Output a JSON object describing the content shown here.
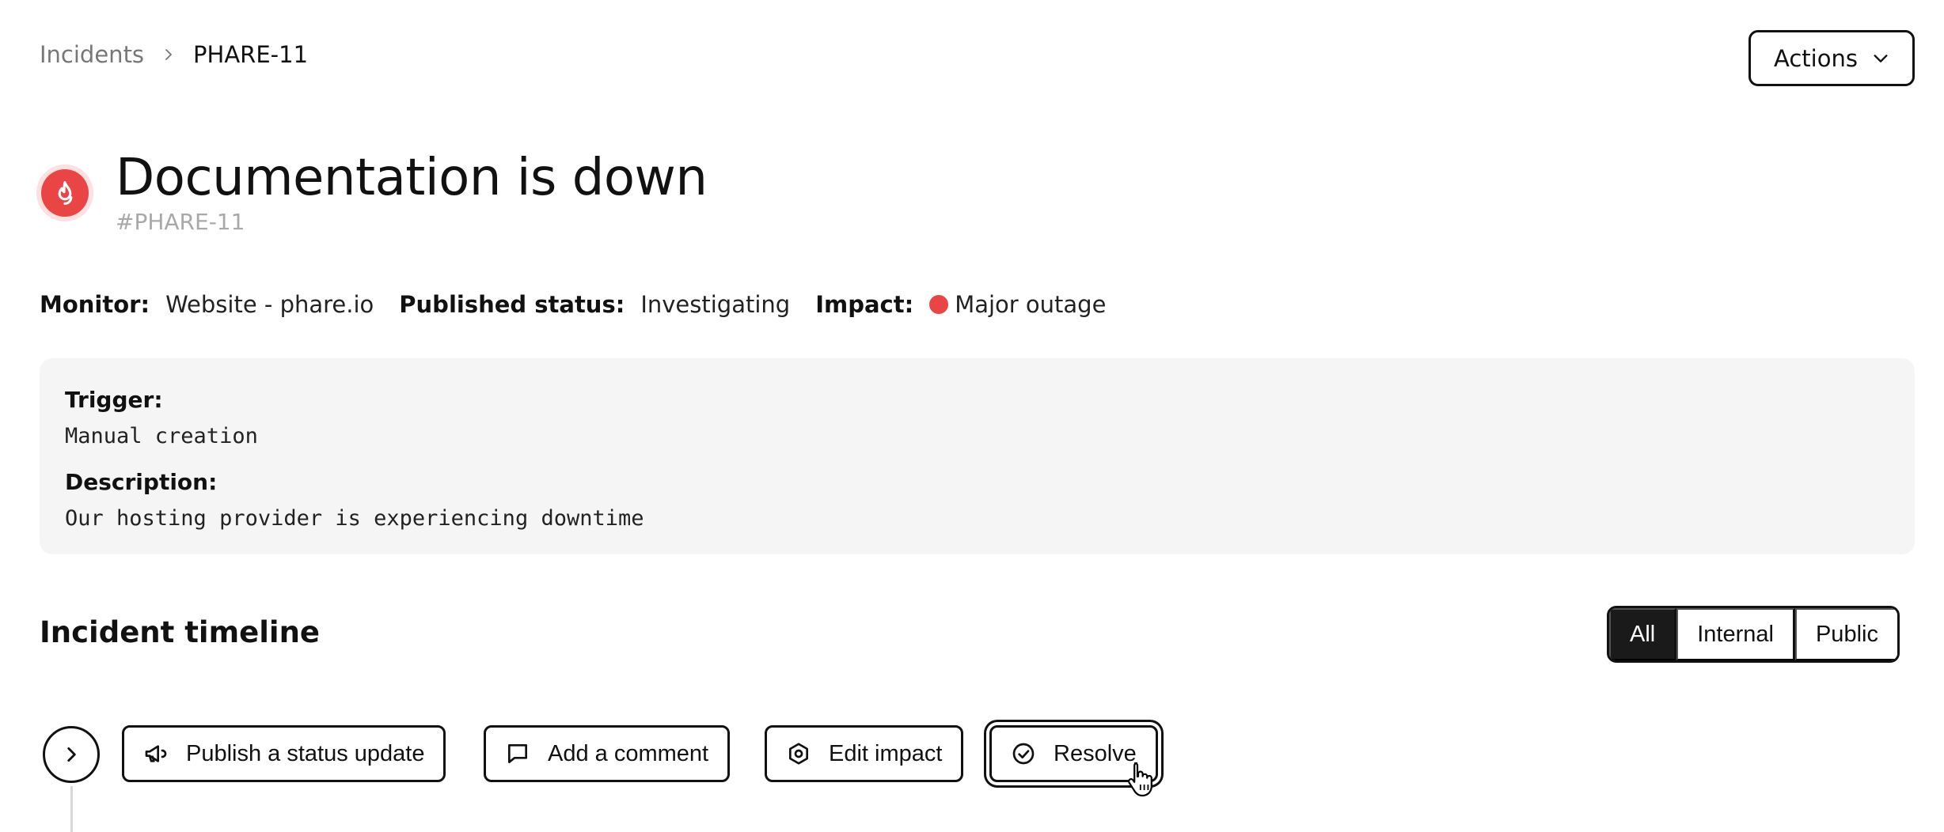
{
  "breadcrumb": {
    "parent": "Incidents",
    "current": "PHARE-11"
  },
  "header": {
    "actions_label": "Actions"
  },
  "incident": {
    "title": "Documentation is down",
    "id_label": "#PHARE-11",
    "status_color": "#ea4545"
  },
  "meta": {
    "monitor_label": "Monitor:",
    "monitor_value": "Website - phare.io",
    "published_label": "Published status:",
    "published_value": "Investigating",
    "impact_label": "Impact:",
    "impact_value": "Major outage"
  },
  "details": {
    "trigger_label": "Trigger:",
    "trigger_value": "Manual creation",
    "description_label": "Description:",
    "description_value": "Our hosting provider is experiencing downtime"
  },
  "timeline": {
    "title": "Incident timeline",
    "filters": [
      {
        "label": "All",
        "active": true
      },
      {
        "label": "Internal",
        "active": false
      },
      {
        "label": "Public",
        "active": false
      }
    ],
    "actions": [
      {
        "label": "Publish a status update",
        "icon": "megaphone-icon"
      },
      {
        "label": "Add a comment",
        "icon": "comment-icon"
      },
      {
        "label": "Edit impact",
        "icon": "hexagon-icon"
      },
      {
        "label": "Resolve",
        "icon": "check-circle-icon"
      }
    ]
  }
}
